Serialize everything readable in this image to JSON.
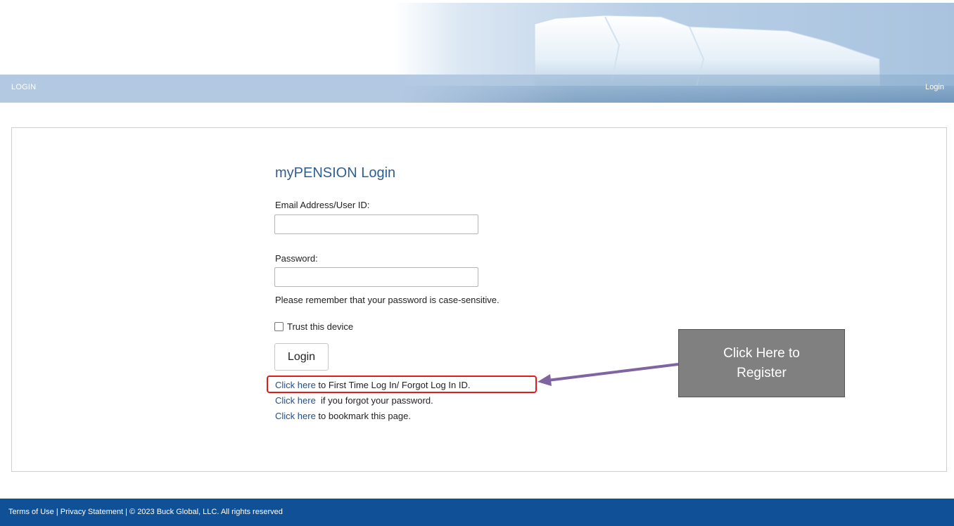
{
  "header": {
    "nav_left": "LOGIN",
    "nav_right": "Login"
  },
  "login": {
    "title": "myPENSION Login",
    "email_label": "Email Address/User ID:",
    "email_value": "",
    "password_label": "Password:",
    "password_value": "",
    "password_note": "Please remember that your password is case-sensitive.",
    "trust_label": "Trust this device",
    "trust_checked": false,
    "login_button": "Login"
  },
  "links": [
    {
      "link_text": "Click here",
      "rest": " to First Time Log In/ Forgot Log In ID."
    },
    {
      "link_text": "Click here",
      "rest": "  if you forgot your password."
    },
    {
      "link_text": "Click here",
      "rest": " to bookmark this page."
    }
  ],
  "callout": {
    "text": "Click Here to Register"
  },
  "footer": {
    "terms": "Terms of Use",
    "sep1": " | ",
    "privacy": "Privacy Statement",
    "sep2": " | ",
    "copyright": "© 2023 Buck Global, LLC. All rights reserved"
  },
  "colors": {
    "title_blue": "#2d5f91",
    "link_blue": "#1f4f8c",
    "footer_bg": "#0f5096",
    "highlight_red": "#e01b1b",
    "callout_gray": "#808080",
    "arrow_purple": "#8064a2"
  }
}
